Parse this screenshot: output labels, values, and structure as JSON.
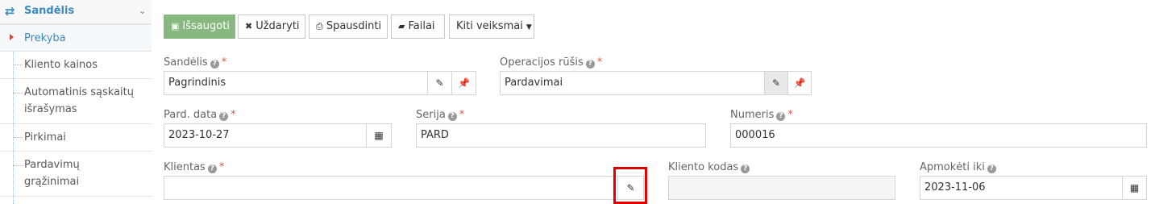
{
  "sidebar": {
    "section_title": "Sandėlis",
    "items": [
      {
        "label": "Prekyba",
        "active": true
      },
      {
        "label": "Kliento kainos"
      },
      {
        "label": "Automatinis sąskaitų",
        "label2": "išrašymas"
      },
      {
        "label": "Pirkimai"
      },
      {
        "label": "Pardavimų",
        "label2": "grąžinimai"
      }
    ]
  },
  "toolbar": {
    "save_label": "Išsaugoti",
    "close_label": "Uždaryti",
    "print_label": "Spausdinti",
    "files_label": "Failai",
    "more_label": "Kiti veiksmai"
  },
  "form": {
    "warehouse": {
      "label": "Sandėlis",
      "value": "Pagrindinis"
    },
    "operation_type": {
      "label": "Operacijos rūšis",
      "value": "Pardavimai"
    },
    "sale_date": {
      "label": "Pard. data",
      "value": "2023-10-27"
    },
    "series": {
      "label": "Serija",
      "value": "PARD"
    },
    "number": {
      "label": "Numeris",
      "value": "000016"
    },
    "client": {
      "label": "Klientas",
      "value": ""
    },
    "client_code": {
      "label": "Kliento kodas",
      "value": ""
    },
    "pay_until": {
      "label": "Apmokėti iki",
      "value": "2023-11-06"
    }
  },
  "colors": {
    "accent": "#3b8ac4",
    "primary_button": "#87b87f",
    "required": "#d15b47",
    "highlight": "#e00000"
  }
}
